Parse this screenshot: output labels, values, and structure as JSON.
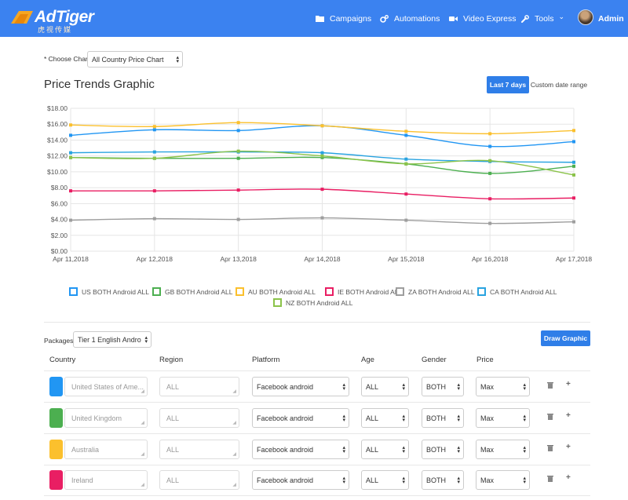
{
  "brand": {
    "name": "AdTiger",
    "subtitle": "虎视传媒"
  },
  "nav": {
    "items": [
      {
        "label": "Campaigns",
        "icon": "folder-icon"
      },
      {
        "label": "Automations",
        "icon": "gears-icon"
      },
      {
        "label": "Video Express",
        "icon": "video-camera-icon"
      },
      {
        "label": "Tools",
        "icon": "wrench-icon"
      }
    ],
    "tools_caret": "⌄",
    "user": "Admin"
  },
  "chooser": {
    "label": "* Choose Chart:",
    "selected": "All Country Price Chart"
  },
  "page_title": "Price Trends Graphic",
  "range": {
    "active": "Last 7 days",
    "custom": "Custom date range"
  },
  "chart_data": {
    "type": "line",
    "x": [
      "Apr 11,2018",
      "Apr 12,2018",
      "Apr 13,2018",
      "Apr 14,2018",
      "Apr 15,2018",
      "Apr 16,2018",
      "Apr 17,2018"
    ],
    "y_ticks": [
      "$0.00",
      "$2.00",
      "$4.00",
      "$6.00",
      "$8.00",
      "$10.00",
      "$12.00",
      "$14.00",
      "$16.00",
      "$18.00"
    ],
    "ylim": [
      0,
      18
    ],
    "series": [
      {
        "name": "US  BOTH Android ALL",
        "color": "#2196f3",
        "values": [
          14.6,
          15.3,
          15.2,
          15.8,
          14.6,
          13.2,
          13.8
        ]
      },
      {
        "name": "GB  BOTH Android ALL",
        "color": "#4caf50",
        "values": [
          11.8,
          11.7,
          11.7,
          11.8,
          11.0,
          9.8,
          10.7
        ]
      },
      {
        "name": "AU  BOTH Android ALL",
        "color": "#fbc02d",
        "values": [
          15.9,
          15.7,
          16.2,
          15.8,
          15.1,
          14.8,
          15.2
        ]
      },
      {
        "name": "IE  BOTH Android ALL",
        "color": "#e91e63",
        "values": [
          7.6,
          7.6,
          7.7,
          7.8,
          7.2,
          6.6,
          6.7
        ]
      },
      {
        "name": "ZA  BOTH Android ALL",
        "color": "#9e9e9e",
        "values": [
          3.9,
          4.1,
          4.0,
          4.2,
          3.9,
          3.5,
          3.7
        ]
      },
      {
        "name": "CA  BOTH Android ALL",
        "color": "#29a3e0",
        "values": [
          12.4,
          12.5,
          12.5,
          12.4,
          11.6,
          11.3,
          11.2
        ]
      },
      {
        "name": "NZ  BOTH Android ALL",
        "color": "#8bc34a",
        "values": [
          11.8,
          11.7,
          12.6,
          12.0,
          11.0,
          11.4,
          9.6
        ]
      }
    ]
  },
  "packages": {
    "label": "Packages:",
    "selected": "Tier 1 English Andro"
  },
  "draw_button": "Draw Graphic",
  "table": {
    "headers": [
      "Country",
      "Region",
      "Platform",
      "Age",
      "Gender",
      "Price"
    ],
    "rows": [
      {
        "color": "#2196f3",
        "country": "United States of Ame...",
        "region": "ALL",
        "platform": "Facebook android",
        "age": "ALL",
        "gender": "BOTH",
        "price": "Max"
      },
      {
        "color": "#4caf50",
        "country": "United Kingdom",
        "region": "ALL",
        "platform": "Facebook android",
        "age": "ALL",
        "gender": "BOTH",
        "price": "Max"
      },
      {
        "color": "#fbc02d",
        "country": "Australia",
        "region": "ALL",
        "platform": "Facebook android",
        "age": "ALL",
        "gender": "BOTH",
        "price": "Max"
      },
      {
        "color": "#e91e63",
        "country": "Ireland",
        "region": "ALL",
        "platform": "Facebook android",
        "age": "ALL",
        "gender": "BOTH",
        "price": "Max"
      }
    ]
  },
  "colors": {
    "topbar": "#3b82f0",
    "primary_button": "#2f7ee8",
    "logo_accent": "#f5a623"
  }
}
